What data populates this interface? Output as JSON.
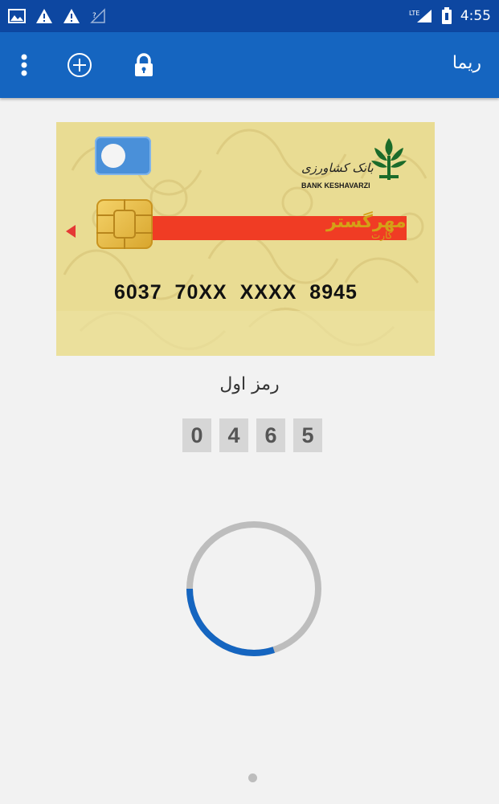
{
  "status_bar": {
    "time": "4:55",
    "network": "LTE",
    "icons": [
      "image-icon",
      "warning-icon",
      "warning-icon",
      "signal-icon",
      "lte-signal-icon",
      "battery-icon"
    ]
  },
  "app_bar": {
    "title": "ریما",
    "icons": [
      "more-vert-icon",
      "add-circle-icon",
      "lock-icon"
    ]
  },
  "card": {
    "bank_name_fa": "بانک کشاورزی",
    "bank_name_en": "BANK KESHAVARZI",
    "brand": "مهرگستر",
    "brand_sub": "کارت",
    "number": "6037 70XX XXXX 8945",
    "colors": {
      "background": "#e9dc93",
      "stripe": "#f03c24",
      "contactless": "#4a90d9"
    }
  },
  "pin": {
    "label": "رمز اول",
    "digits": [
      "0",
      "4",
      "6",
      "5"
    ]
  },
  "progress": {
    "fraction": 0.3,
    "color": "#1565c0",
    "track_color": "#bdbdbd"
  },
  "pager": {
    "count": 1,
    "active": 0
  }
}
